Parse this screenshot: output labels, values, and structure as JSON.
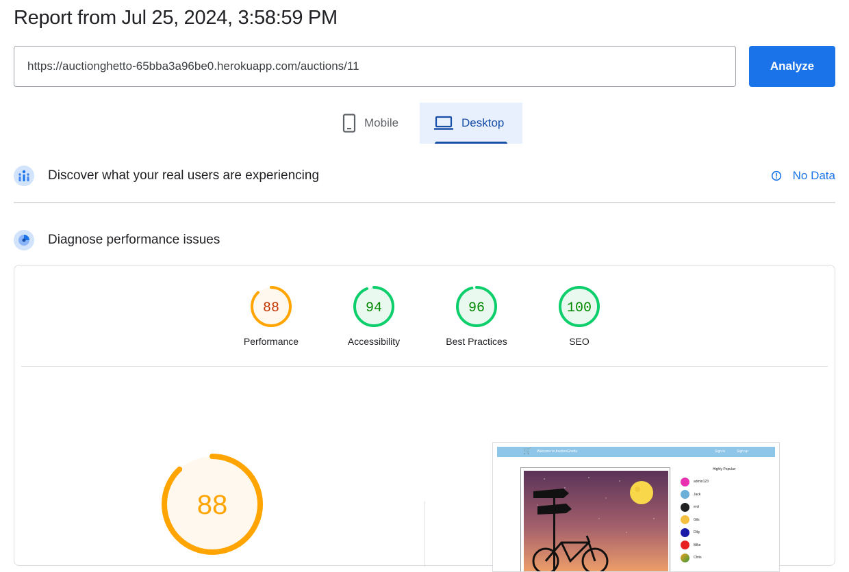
{
  "report": {
    "title": "Report from Jul 25, 2024, 3:58:59 PM"
  },
  "search": {
    "url": "https://auctionghetto-65bba3a96be0.herokuapp.com/auctions/11",
    "analyze_label": "Analyze"
  },
  "tabs": [
    {
      "label": "Mobile",
      "icon": "phone-icon",
      "selected": false
    },
    {
      "label": "Desktop",
      "icon": "laptop-icon",
      "selected": true
    }
  ],
  "crux": {
    "title": "Discover what your real users are experiencing",
    "status": "No Data"
  },
  "diagnose": {
    "title": "Diagnose performance issues"
  },
  "scores": [
    {
      "value": 88,
      "label": "Performance",
      "rating": "average"
    },
    {
      "value": 94,
      "label": "Accessibility",
      "rating": "pass"
    },
    {
      "value": 96,
      "label": "Best Practices",
      "rating": "pass"
    },
    {
      "value": 100,
      "label": "SEO",
      "rating": "pass"
    }
  ],
  "main_score": {
    "value": 88
  },
  "colors": {
    "accent": "#1a73e8",
    "average": "#ffa400",
    "average_text": "#c33300",
    "average_bg": "#fff8ee",
    "pass": "#0cce6b",
    "pass_text": "#008800",
    "pass_bg": "#eaf9f0"
  },
  "screenshot": {
    "nav_brand": "Welcome to AuctionGhetto",
    "nav_signin": "Sign in",
    "nav_signup": "Sign up",
    "sidebar_title": "Highly Popular:",
    "users": [
      "admin123",
      "Jack",
      "erol",
      "Gils",
      "Dilg",
      "Mike",
      "Chris"
    ]
  }
}
